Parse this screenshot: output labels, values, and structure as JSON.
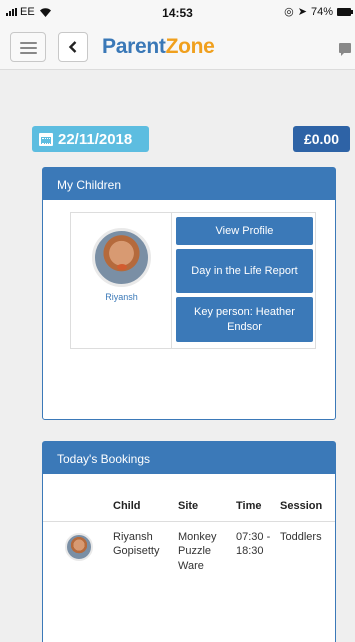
{
  "statusbar": {
    "carrier": "EE",
    "time": "14:53",
    "battery": "74%"
  },
  "navbar": {
    "brand_part1": "Parent",
    "brand_part2": "Zone",
    "icons": [
      "menu-icon",
      "chevron-left-icon",
      "chat-icon"
    ]
  },
  "summary": {
    "date": "22/11/2018",
    "balance": "£0.00",
    "date_icon": "calendar-icon"
  },
  "children_panel": {
    "title": "My Children",
    "child": {
      "name": "Riyansh"
    },
    "buttons": {
      "view_profile": "View Profile",
      "day_report": "Day in the Life Report",
      "key_person": "Key person: Heather Endsor"
    }
  },
  "bookings_panel": {
    "title": "Today's Bookings",
    "columns": {
      "child": "Child",
      "site": "Site",
      "time": "Time",
      "session": "Session"
    },
    "rows": [
      {
        "child": "Riyansh Gopisetty",
        "site": "Monkey Puzzle Ware",
        "time": "07:30 - 18:30",
        "session": "Toddlers"
      }
    ]
  },
  "colors": {
    "primary": "#3b79b8",
    "accent": "#f0a01e",
    "date_bg": "#5dbde0",
    "balance_bg": "#2e63a6"
  }
}
